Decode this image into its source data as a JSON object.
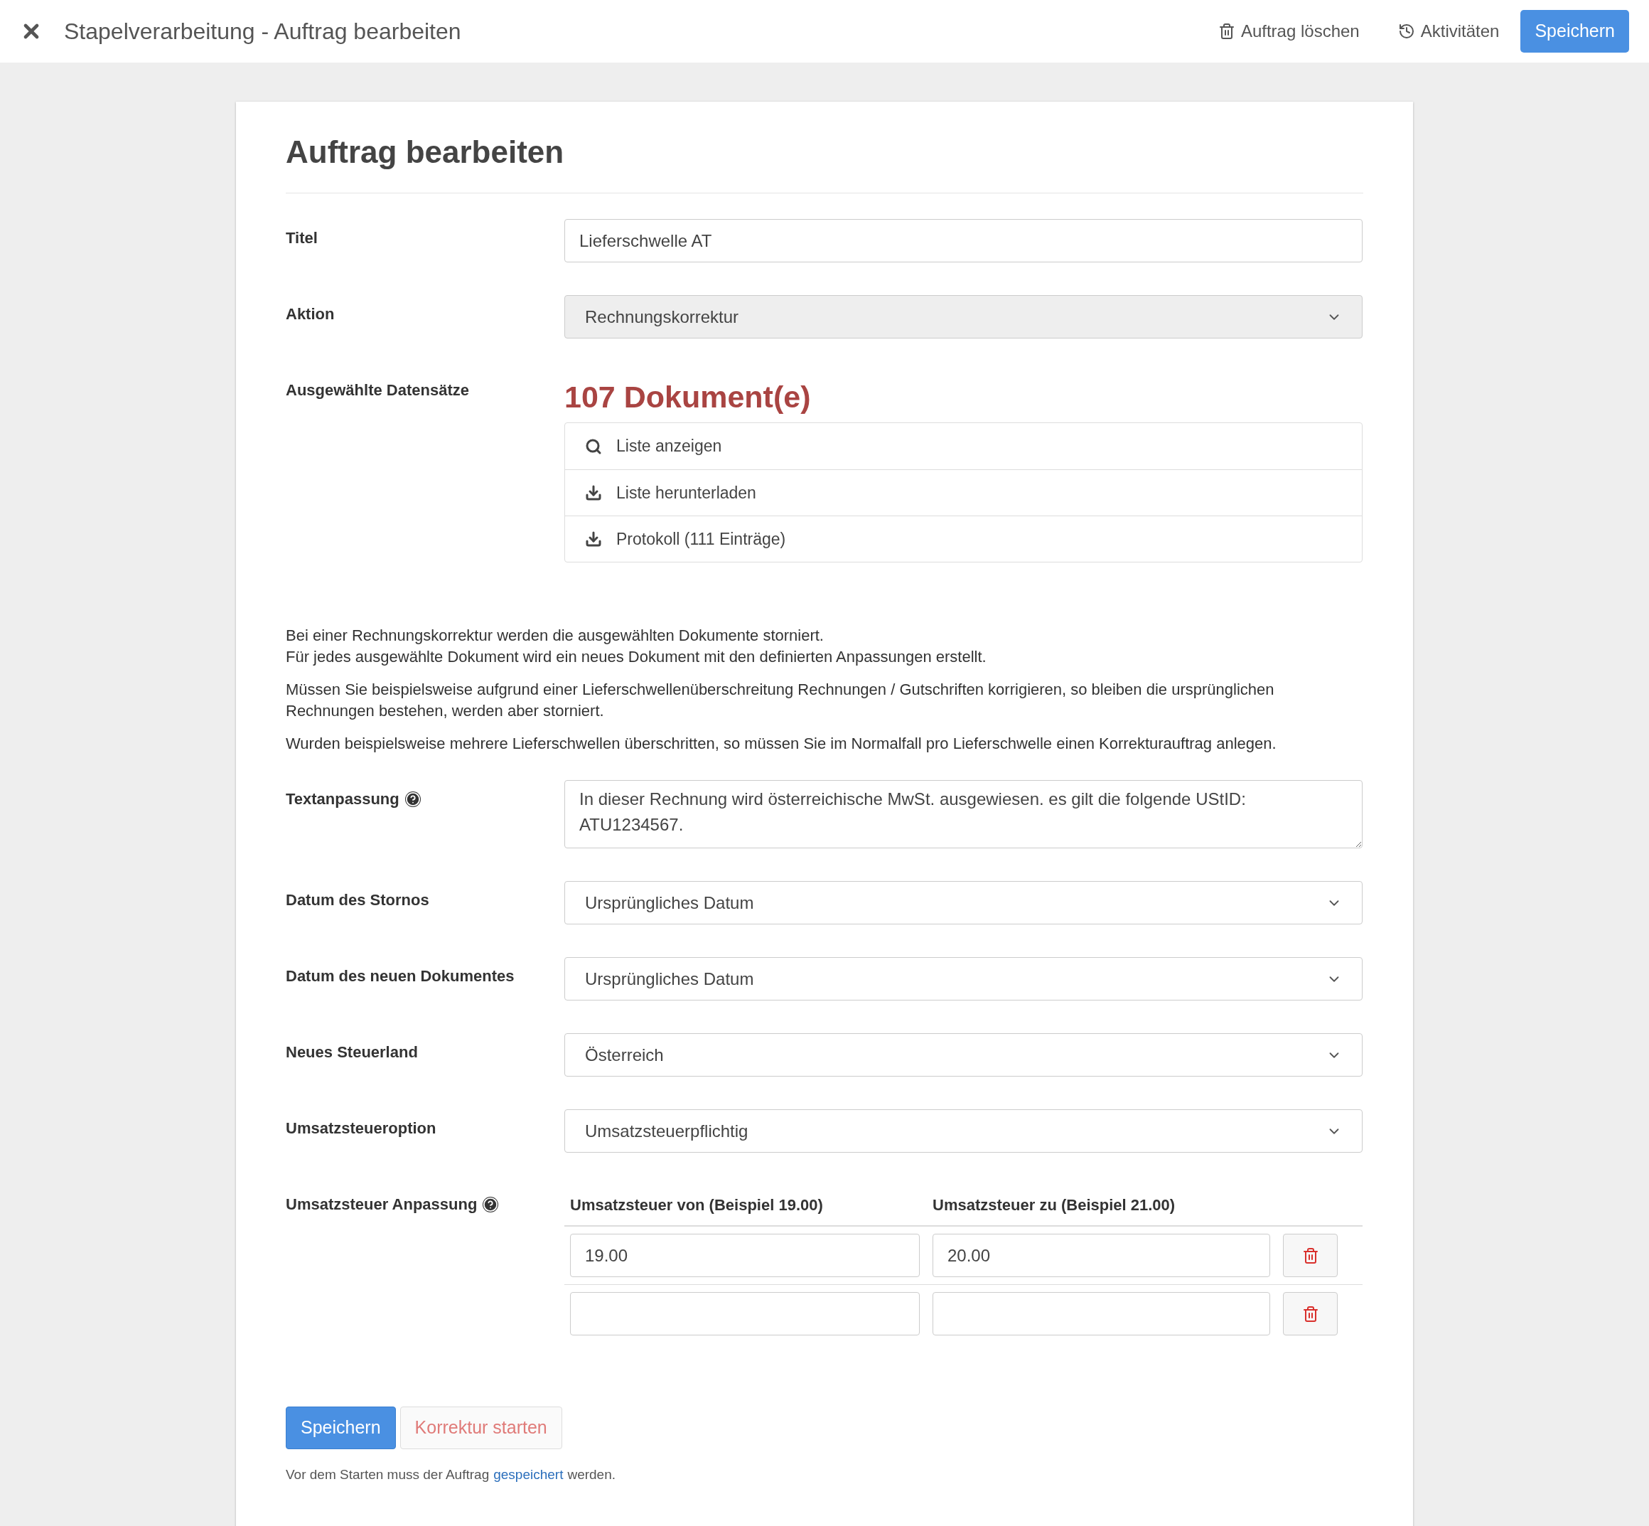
{
  "header": {
    "title": "Stapelverarbeitung - Auftrag bearbeiten",
    "actions": [
      {
        "label": "Auftrag löschen",
        "kind": "delete"
      },
      {
        "label": "Aktivitäten",
        "kind": "history"
      }
    ],
    "primary": "Speichern"
  },
  "card": {
    "title": "Auftrag bearbeiten",
    "title_field": {
      "label": "Titel",
      "value": "Lieferschwelle AT"
    },
    "action_field": {
      "label": "Aktion",
      "value": "Rechnungskorrektur",
      "disabled": true
    },
    "records": {
      "label": "Ausgewählte Datensätze",
      "count": "107 Dokument(e)",
      "items": [
        {
          "label": "Liste anzeigen",
          "kind": "search"
        },
        {
          "label": "Liste herunterladen",
          "kind": "download"
        },
        {
          "label": "Protokoll (111 Einträge)",
          "kind": "download"
        }
      ]
    },
    "info_paragraphs": [
      [
        "Bei einer Rechnungskorrektur werden die ausgewählten Dokumente storniert.",
        "Für jedes ausgewählte Dokument wird ein neues Dokument mit den definierten Anpassungen erstellt."
      ],
      [
        "Müssen Sie beispielsweise aufgrund einer Lieferschwellenüberschreitung Rechnungen / Gutschriften korrigieren, so bleiben die ursprünglichen Rechnungen bestehen, werden aber storniert."
      ],
      [
        "Wurden beispielsweise mehrere Lieferschwellen überschritten, so müssen Sie im Normalfall pro Lieferschwelle einen Korrekturauftrag anlegen."
      ]
    ],
    "text_adjust": {
      "label": "Textanpassung",
      "value": "In dieser Rechnung wird österreichische MwSt. ausgewiesen. es gilt die folgende UStID: ATU1234567."
    },
    "selects": [
      {
        "label": "Datum des Stornos",
        "value": "Ursprüngliches Datum"
      },
      {
        "label": "Datum des neuen Dokumentes",
        "value": "Ursprüngliches Datum"
      },
      {
        "label": "Neues Steuerland",
        "value": "Österreich"
      },
      {
        "label": "Umsatzsteueroption",
        "value": "Umsatzsteuerpflichtig"
      }
    ],
    "vat": {
      "label": "Umsatzsteuer Anpassung",
      "columns": [
        "Umsatzsteuer von (Beispiel 19.00)",
        "Umsatzsteuer zu (Beispiel 21.00)"
      ],
      "rows": [
        {
          "from": "19.00",
          "to": "20.00"
        },
        {}
      ]
    },
    "buttons": [
      {
        "label": "Speichern",
        "kind": "primary"
      },
      {
        "label": "Korrektur starten",
        "kind": "danger"
      }
    ],
    "note": {
      "before": "Vor dem Starten muss der Auftrag",
      "link": "gespeichert",
      "after": "werden."
    }
  }
}
